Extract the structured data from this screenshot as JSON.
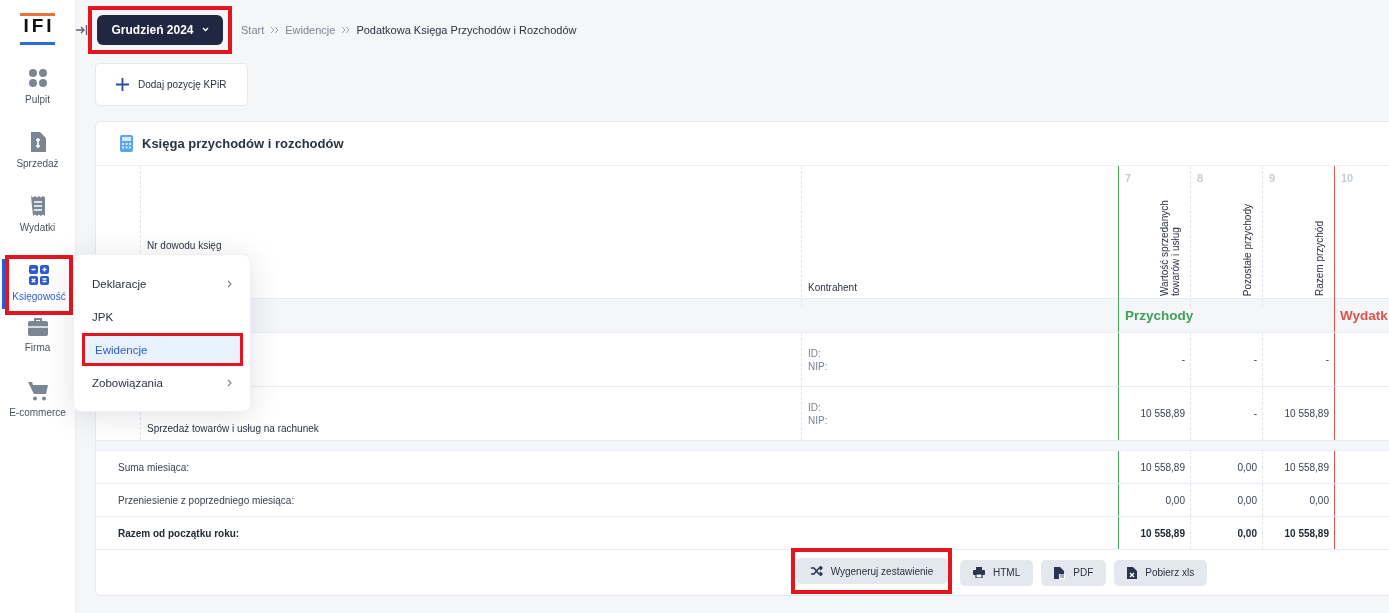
{
  "sidebar": {
    "logo": "IFI",
    "items": [
      {
        "label": "Pulpit",
        "kind": "dots",
        "selected": false,
        "highlighted": false
      },
      {
        "label": "Sprzedaż",
        "kind": "invoice",
        "selected": false,
        "highlighted": false
      },
      {
        "label": "Wydatki",
        "kind": "receipt",
        "selected": false,
        "highlighted": false
      },
      {
        "label": "Księgowość",
        "kind": "calc",
        "selected": true,
        "highlighted": true
      },
      {
        "label": "Firma",
        "kind": "briefcase",
        "selected": false,
        "highlighted": false
      },
      {
        "label": "E-commerce",
        "kind": "cart",
        "selected": false,
        "highlighted": false
      }
    ]
  },
  "submenu": {
    "items": [
      {
        "label": "Deklaracje",
        "has_submenu": true,
        "selected": false,
        "highlighted": false
      },
      {
        "label": "JPK",
        "has_submenu": false,
        "selected": false,
        "highlighted": false
      },
      {
        "label": "Ewidencje",
        "has_submenu": false,
        "selected": true,
        "highlighted": true
      },
      {
        "label": "Zobowiązania",
        "has_submenu": true,
        "selected": false,
        "highlighted": false
      }
    ]
  },
  "month_button": {
    "label": "Grudzień 2024",
    "highlighted": true
  },
  "breadcrumb": [
    "Start",
    "Ewidencje",
    "Podatkowa Księga Przychodów i Rozchodów"
  ],
  "add_button": {
    "label": "Dodaj pozycję KPiR"
  },
  "card": {
    "title": "Księga przychodów i rozchodów"
  },
  "table": {
    "columns": [
      {
        "kind": "blank"
      },
      {
        "label": "Nr dowodu księg",
        "kind": "text"
      },
      {
        "label": "Kontrahent",
        "kind": "text"
      },
      {
        "label": "Wartość sprzedanych towarów i usług",
        "number": "7",
        "kind": "income"
      },
      {
        "label": "Pozostałe przychody",
        "number": "8",
        "kind": "income"
      },
      {
        "label": "Razem przychód",
        "number": "9",
        "kind": "income"
      },
      {
        "number": "10",
        "kind": "expense"
      }
    ],
    "sections": [
      {
        "label": "Przychody",
        "kind": "income"
      },
      {
        "label": "Wydatk",
        "kind": "expense"
      }
    ],
    "rows": [
      {
        "contractor": [
          "ID:",
          "NIP:"
        ],
        "values": [
          "-",
          "-",
          "-"
        ]
      },
      {
        "description": "Sprzedaż towarów i usług na rachunek",
        "contractor": [
          "ID:",
          "NIP:"
        ],
        "values": [
          "10 558,89",
          "-",
          "10 558,89"
        ]
      }
    ],
    "summary": [
      {
        "label": "Suma miesiąca:",
        "bold": false,
        "values": [
          "10 558,89",
          "0,00",
          "10 558,89"
        ]
      },
      {
        "label": "Przeniesienie z poprzedniego miesiąca:",
        "bold": false,
        "values": [
          "0,00",
          "0,00",
          "0,00"
        ]
      },
      {
        "label": "Razem od początku roku:",
        "bold": true,
        "values": [
          "10 558,89",
          "0,00",
          "10 558,89"
        ]
      }
    ]
  },
  "actions": [
    {
      "label": "Wygeneruj zestawienie",
      "kind": "shuffle",
      "highlighted": true
    },
    {
      "label": "HTML",
      "kind": "printer",
      "highlighted": false
    },
    {
      "label": "PDF",
      "kind": "pdf",
      "highlighted": false
    },
    {
      "label": "Pobierz xls",
      "kind": "xls",
      "highlighted": false
    }
  ]
}
